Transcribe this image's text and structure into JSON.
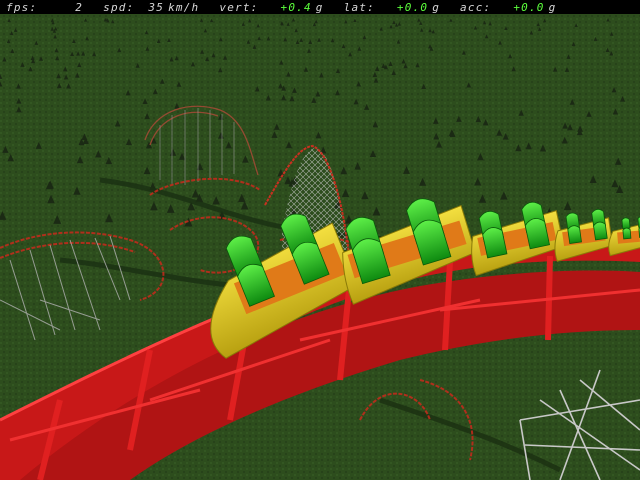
{
  "hud": {
    "fps": {
      "label": "fps:",
      "value": "2"
    },
    "spd": {
      "label": "spd:",
      "value": "35",
      "unit": "km/h"
    },
    "vert": {
      "label": "vert:",
      "value": "+0.4",
      "unit": "g"
    },
    "lat": {
      "label": "lat:",
      "value": "+0.0",
      "unit": "g"
    },
    "acc": {
      "label": "acc:",
      "value": "+0.0",
      "unit": "g"
    }
  },
  "colors": {
    "grass": "#2b4a1c",
    "track": "#d81818",
    "train": "#e6d020",
    "seat": "#22c81e",
    "hud_value_green": "#5cff3c"
  }
}
